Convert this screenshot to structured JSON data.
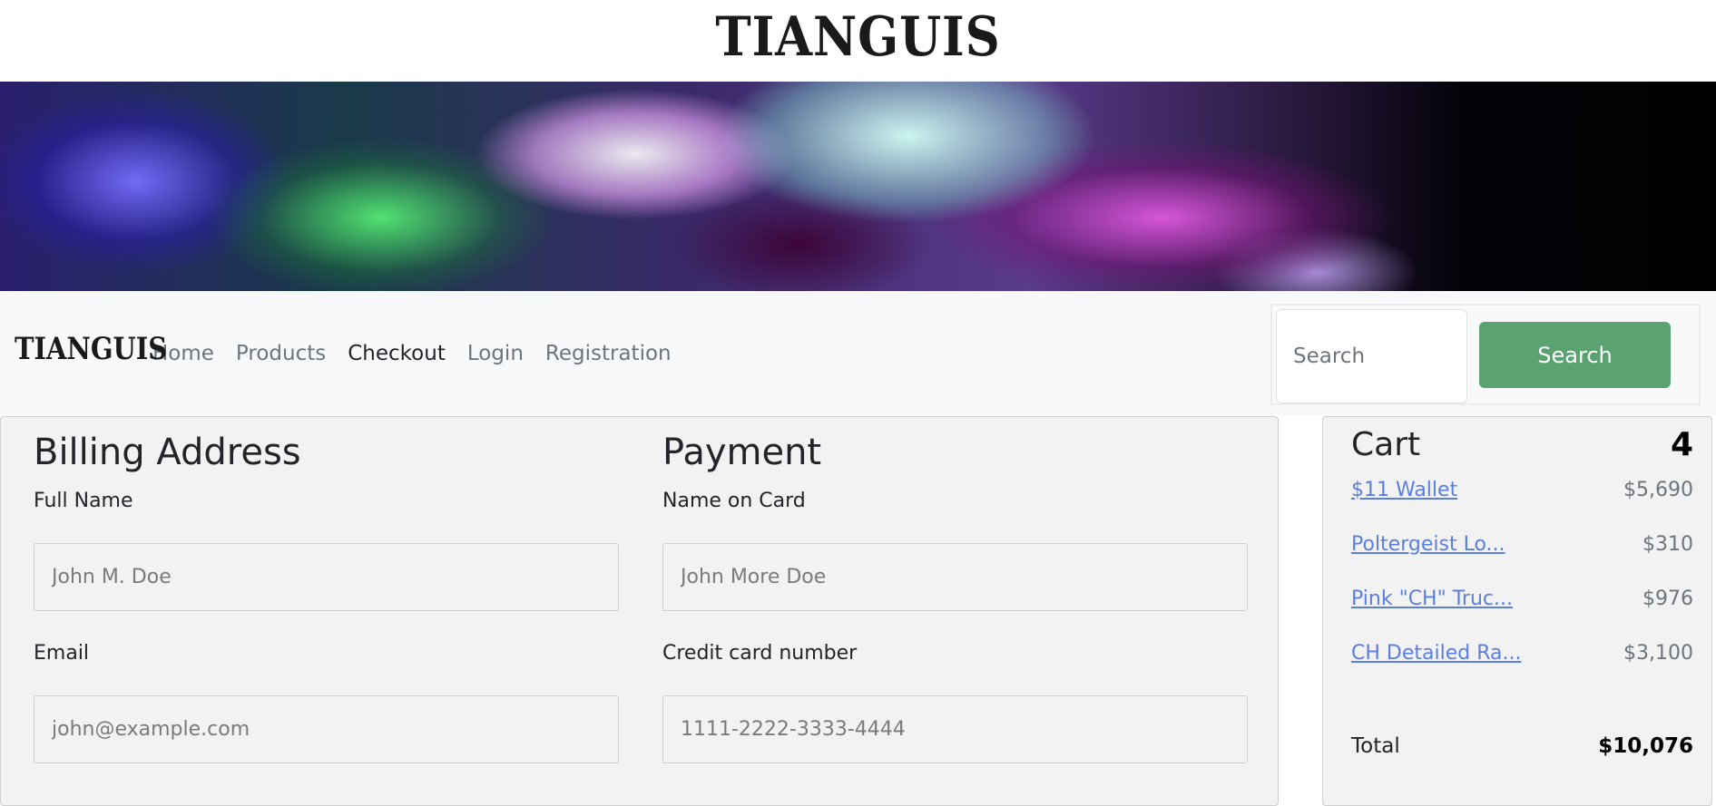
{
  "header": {
    "logo_text": "TIANGUIS"
  },
  "banner": {
    "alt": ""
  },
  "navbar": {
    "brand": "TIANGUIS",
    "links": [
      {
        "label": "Home",
        "active": false
      },
      {
        "label": "Products",
        "active": false
      },
      {
        "label": "Checkout",
        "active": true
      },
      {
        "label": "Login",
        "active": false
      },
      {
        "label": "Registration",
        "active": false
      }
    ],
    "search": {
      "placeholder": "Search",
      "button_label": "Search"
    }
  },
  "billing": {
    "title": "Billing Address",
    "full_name_label": "Full Name",
    "full_name_placeholder": "John M. Doe",
    "email_label": "Email",
    "email_placeholder": "john@example.com"
  },
  "payment": {
    "title": "Payment",
    "name_on_card_label": "Name on Card",
    "name_on_card_placeholder": "John More Doe",
    "card_number_label": "Credit card number",
    "card_number_placeholder": "1111-2222-3333-4444"
  },
  "cart": {
    "title": "Cart",
    "count": "4",
    "items": [
      {
        "name": "$11 Wallet",
        "price": "$5,690"
      },
      {
        "name": "Poltergeist Lo...",
        "price": "$310"
      },
      {
        "name": "Pink \"CH\" Truc...",
        "price": "$976"
      },
      {
        "name": "CH Detailed Ra...",
        "price": "$3,100"
      }
    ],
    "total_label": "Total",
    "total_value": "$10,076"
  },
  "colors": {
    "accent_green": "#5aa370",
    "link_blue": "#5b7fe0",
    "navbar_bg": "#f8f9fa",
    "panel_bg": "#f2f2f2"
  }
}
